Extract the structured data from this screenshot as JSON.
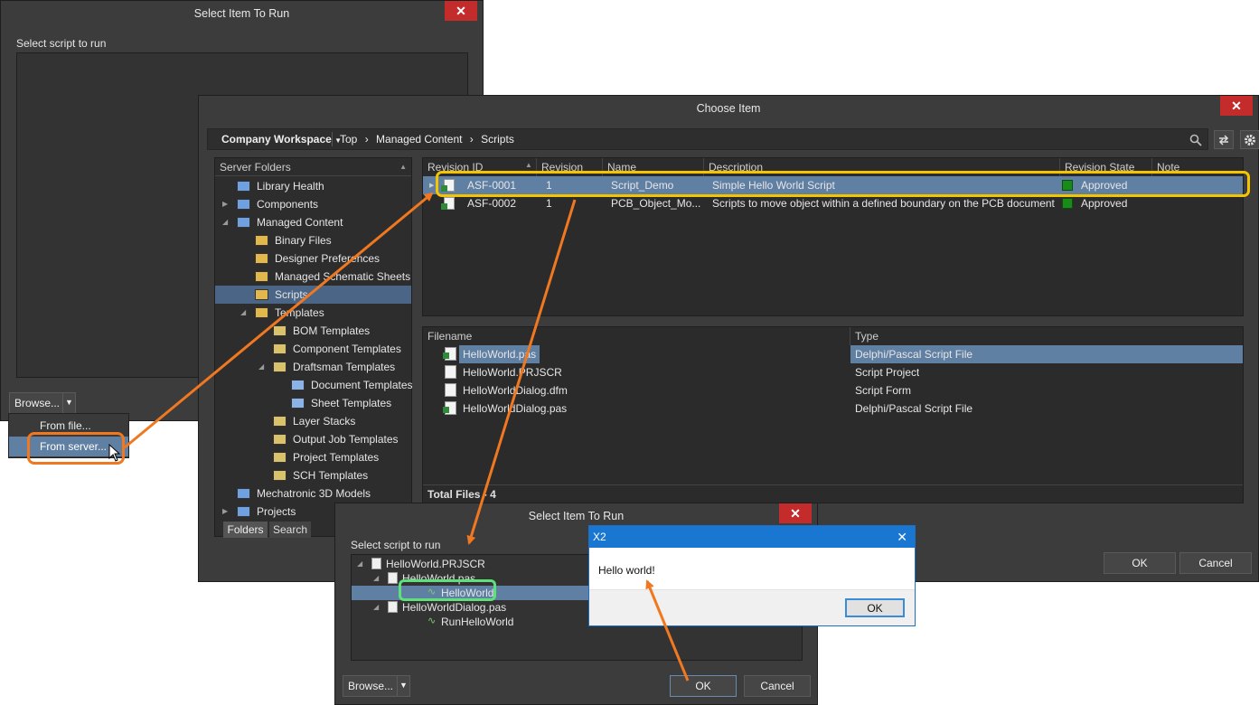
{
  "dialog_back": {
    "title": "Select Item To Run",
    "close": "✕",
    "label": "Select script to run",
    "browse_label": "Browse...",
    "menu": [
      "From file...",
      "From server..."
    ]
  },
  "choose": {
    "title": "Choose Item",
    "close": "✕",
    "workspace": "Company Workspace",
    "breadcrumb": [
      "Top",
      "Managed Content",
      "Scripts"
    ],
    "folders_header": "Server Folders",
    "folders": [
      {
        "label": "Library Health",
        "depth": 0,
        "expander": ""
      },
      {
        "label": "Components",
        "depth": 0,
        "expander": "▶"
      },
      {
        "label": "Managed Content",
        "depth": 0,
        "expander": "◢"
      },
      {
        "label": "Binary Files",
        "depth": 1,
        "expander": ""
      },
      {
        "label": "Designer Preferences",
        "depth": 1,
        "expander": ""
      },
      {
        "label": "Managed Schematic Sheets",
        "depth": 1,
        "expander": ""
      },
      {
        "label": "Scripts",
        "depth": 1,
        "expander": "",
        "selected": true
      },
      {
        "label": "Templates",
        "depth": 1,
        "expander": "◢"
      },
      {
        "label": "BOM Templates",
        "depth": 2,
        "expander": ""
      },
      {
        "label": "Component Templates",
        "depth": 2,
        "expander": ""
      },
      {
        "label": "Draftsman Templates",
        "depth": 2,
        "expander": "◢"
      },
      {
        "label": "Document Templates",
        "depth": 3,
        "expander": ""
      },
      {
        "label": "Sheet Templates",
        "depth": 3,
        "expander": ""
      },
      {
        "label": "Layer Stacks",
        "depth": 2,
        "expander": ""
      },
      {
        "label": "Output Job Templates",
        "depth": 2,
        "expander": ""
      },
      {
        "label": "Project Templates",
        "depth": 2,
        "expander": ""
      },
      {
        "label": "SCH Templates",
        "depth": 2,
        "expander": ""
      },
      {
        "label": "Mechatronic 3D Models",
        "depth": 0,
        "expander": ""
      },
      {
        "label": "Projects",
        "depth": 0,
        "expander": "▶"
      }
    ],
    "tabs": [
      "Folders",
      "Search"
    ],
    "items_columns": [
      "Revision ID",
      "Revision",
      "Name",
      "Description",
      "Revision State",
      "Note"
    ],
    "items": [
      {
        "id": "ASF-0001",
        "revision": "1",
        "name": "Script_Demo",
        "description": "Simple Hello World Script",
        "state": "Approved",
        "selected": true
      },
      {
        "id": "ASF-0002",
        "revision": "1",
        "name": "PCB_Object_Mo...",
        "description": "Scripts to move object within a defined boundary on the PCB document",
        "state": "Approved"
      }
    ],
    "files_columns": [
      "Filename",
      "Type"
    ],
    "files": [
      {
        "name": "HelloWorld.pas",
        "type": "Delphi/Pascal Script File",
        "icon": "pas",
        "selected": true
      },
      {
        "name": "HelloWorld.PRJSCR",
        "type": "Script Project",
        "icon": "doc"
      },
      {
        "name": "HelloWorldDialog.dfm",
        "type": "Script Form",
        "icon": "doc"
      },
      {
        "name": "HelloWorldDialog.pas",
        "type": "Delphi/Pascal Script File",
        "icon": "pas"
      }
    ],
    "total_files": "Total Files - 4",
    "ok": "OK",
    "cancel": "Cancel"
  },
  "dialog_front": {
    "title": "Select Item To Run",
    "close": "✕",
    "label": "Select script to run",
    "tree": [
      {
        "label": "HelloWorld.PRJSCR",
        "depth": 0,
        "expander": "◢"
      },
      {
        "label": "HelloWorld.pas",
        "depth": 1,
        "expander": "◢"
      },
      {
        "label": "HelloWorld",
        "depth": 2,
        "expander": "",
        "selected": true
      },
      {
        "label": "HelloWorldDialog.pas",
        "depth": 1,
        "expander": "◢"
      },
      {
        "label": "RunHelloWorld",
        "depth": 2,
        "expander": ""
      }
    ],
    "browse_label": "Browse...",
    "ok": "OK",
    "cancel": "Cancel"
  },
  "msgbox": {
    "title": "X2",
    "close": "✕",
    "message": "Hello world!",
    "ok": "OK"
  },
  "colors": {
    "highlight_orange": "#f07820",
    "highlight_yellow": "#f5c400",
    "highlight_green": "#5ee07a",
    "selection": "#5f7fa3",
    "approved": "#1a8a1a"
  }
}
